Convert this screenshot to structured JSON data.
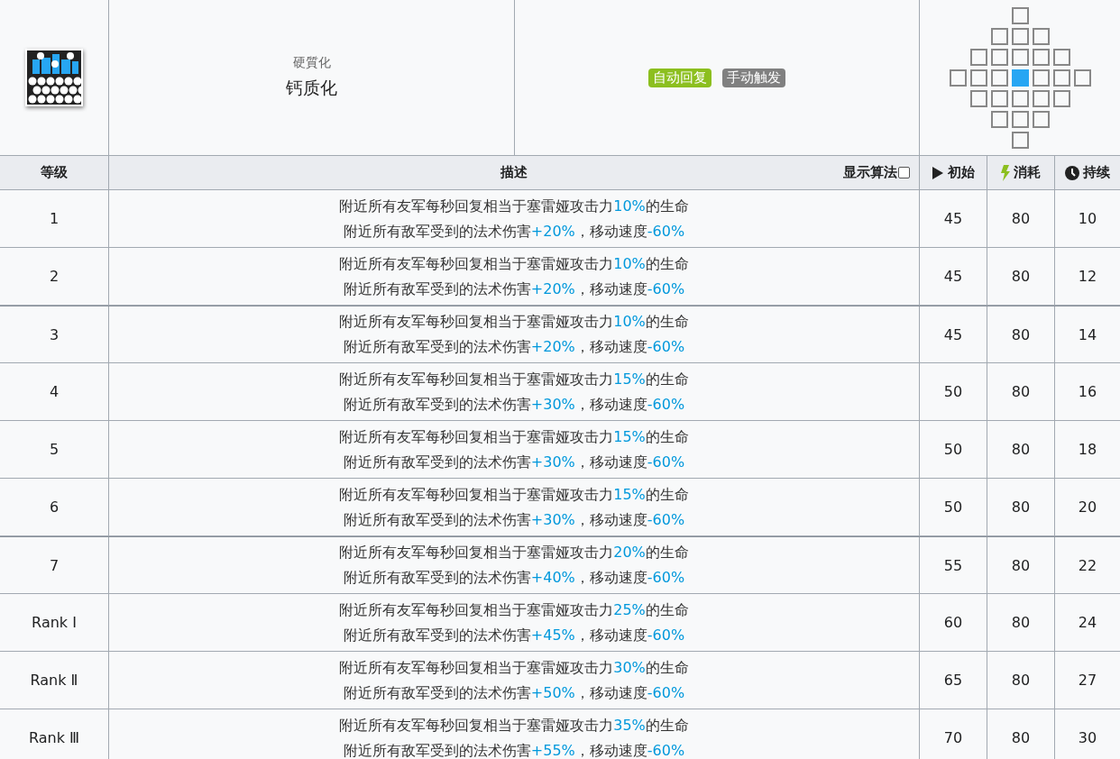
{
  "skill": {
    "subtitle": "硬質化",
    "name": "钙质化",
    "tags": [
      {
        "label": "自动回复",
        "color": "#8cbf1f"
      },
      {
        "label": "手动触发",
        "color": "#808080"
      }
    ]
  },
  "range": {
    "rows": [
      [
        {
          "selected": false
        }
      ],
      [
        {
          "selected": false
        },
        {
          "selected": false
        },
        {
          "selected": false
        }
      ],
      [
        {
          "selected": false
        },
        {
          "selected": false
        },
        {
          "selected": false
        },
        {
          "selected": false
        },
        {
          "selected": false
        }
      ],
      [
        {
          "selected": false
        },
        {
          "selected": false
        },
        {
          "selected": false
        },
        {
          "selected": true
        },
        {
          "selected": false
        },
        {
          "selected": false
        },
        {
          "selected": false
        }
      ],
      [
        {
          "selected": false
        },
        {
          "selected": false
        },
        {
          "selected": false
        },
        {
          "selected": false
        },
        {
          "selected": false
        }
      ],
      [
        {
          "selected": false
        },
        {
          "selected": false
        },
        {
          "selected": false
        }
      ],
      [
        {
          "selected": false
        }
      ]
    ]
  },
  "table": {
    "columns": {
      "level": "等级",
      "description": "描述",
      "formula_toggle": {
        "label": "显示算法",
        "checked": false
      },
      "initial": "初始",
      "cost": "消耗",
      "duration": "持续"
    },
    "rows": [
      {
        "level": "1",
        "strong_top": false,
        "lines": [
          [
            {
              "text": "附近所有友军每秒回复相当于塞雷娅攻击力",
              "highlight": false
            },
            {
              "text": "10%",
              "highlight": true
            },
            {
              "text": "的生命",
              "highlight": false
            }
          ],
          [
            {
              "text": "附近所有敌军受到的法术伤害",
              "highlight": false
            },
            {
              "text": "+20%",
              "highlight": true
            },
            {
              "text": "，移动速度",
              "highlight": false
            },
            {
              "text": "-60%",
              "highlight": true
            }
          ]
        ],
        "initial": "45",
        "cost": "80",
        "duration": "10"
      },
      {
        "level": "2",
        "strong_top": false,
        "lines": [
          [
            {
              "text": "附近所有友军每秒回复相当于塞雷娅攻击力",
              "highlight": false
            },
            {
              "text": "10%",
              "highlight": true
            },
            {
              "text": "的生命",
              "highlight": false
            }
          ],
          [
            {
              "text": "附近所有敌军受到的法术伤害",
              "highlight": false
            },
            {
              "text": "+20%",
              "highlight": true
            },
            {
              "text": "，移动速度",
              "highlight": false
            },
            {
              "text": "-60%",
              "highlight": true
            }
          ]
        ],
        "initial": "45",
        "cost": "80",
        "duration": "12"
      },
      {
        "level": "3",
        "strong_top": true,
        "lines": [
          [
            {
              "text": "附近所有友军每秒回复相当于塞雷娅攻击力",
              "highlight": false
            },
            {
              "text": "10%",
              "highlight": true
            },
            {
              "text": "的生命",
              "highlight": false
            }
          ],
          [
            {
              "text": "附近所有敌军受到的法术伤害",
              "highlight": false
            },
            {
              "text": "+20%",
              "highlight": true
            },
            {
              "text": "，移动速度",
              "highlight": false
            },
            {
              "text": "-60%",
              "highlight": true
            }
          ]
        ],
        "initial": "45",
        "cost": "80",
        "duration": "14"
      },
      {
        "level": "4",
        "strong_top": false,
        "lines": [
          [
            {
              "text": "附近所有友军每秒回复相当于塞雷娅攻击力",
              "highlight": false
            },
            {
              "text": "15%",
              "highlight": true
            },
            {
              "text": "的生命",
              "highlight": false
            }
          ],
          [
            {
              "text": "附近所有敌军受到的法术伤害",
              "highlight": false
            },
            {
              "text": "+30%",
              "highlight": true
            },
            {
              "text": "，移动速度",
              "highlight": false
            },
            {
              "text": "-60%",
              "highlight": true
            }
          ]
        ],
        "initial": "50",
        "cost": "80",
        "duration": "16"
      },
      {
        "level": "5",
        "strong_top": false,
        "lines": [
          [
            {
              "text": "附近所有友军每秒回复相当于塞雷娅攻击力",
              "highlight": false
            },
            {
              "text": "15%",
              "highlight": true
            },
            {
              "text": "的生命",
              "highlight": false
            }
          ],
          [
            {
              "text": "附近所有敌军受到的法术伤害",
              "highlight": false
            },
            {
              "text": "+30%",
              "highlight": true
            },
            {
              "text": "，移动速度",
              "highlight": false
            },
            {
              "text": "-60%",
              "highlight": true
            }
          ]
        ],
        "initial": "50",
        "cost": "80",
        "duration": "18"
      },
      {
        "level": "6",
        "strong_top": false,
        "lines": [
          [
            {
              "text": "附近所有友军每秒回复相当于塞雷娅攻击力",
              "highlight": false
            },
            {
              "text": "15%",
              "highlight": true
            },
            {
              "text": "的生命",
              "highlight": false
            }
          ],
          [
            {
              "text": "附近所有敌军受到的法术伤害",
              "highlight": false
            },
            {
              "text": "+30%",
              "highlight": true
            },
            {
              "text": "，移动速度",
              "highlight": false
            },
            {
              "text": "-60%",
              "highlight": true
            }
          ]
        ],
        "initial": "50",
        "cost": "80",
        "duration": "20"
      },
      {
        "level": "7",
        "strong_top": true,
        "lines": [
          [
            {
              "text": "附近所有友军每秒回复相当于塞雷娅攻击力",
              "highlight": false
            },
            {
              "text": "20%",
              "highlight": true
            },
            {
              "text": "的生命",
              "highlight": false
            }
          ],
          [
            {
              "text": "附近所有敌军受到的法术伤害",
              "highlight": false
            },
            {
              "text": "+40%",
              "highlight": true
            },
            {
              "text": "，移动速度",
              "highlight": false
            },
            {
              "text": "-60%",
              "highlight": true
            }
          ]
        ],
        "initial": "55",
        "cost": "80",
        "duration": "22"
      },
      {
        "level": "Rank Ⅰ",
        "strong_top": false,
        "lines": [
          [
            {
              "text": "附近所有友军每秒回复相当于塞雷娅攻击力",
              "highlight": false
            },
            {
              "text": "25%",
              "highlight": true
            },
            {
              "text": "的生命",
              "highlight": false
            }
          ],
          [
            {
              "text": "附近所有敌军受到的法术伤害",
              "highlight": false
            },
            {
              "text": "+45%",
              "highlight": true
            },
            {
              "text": "，移动速度",
              "highlight": false
            },
            {
              "text": "-60%",
              "highlight": true
            }
          ]
        ],
        "initial": "60",
        "cost": "80",
        "duration": "24"
      },
      {
        "level": "Rank Ⅱ",
        "strong_top": false,
        "lines": [
          [
            {
              "text": "附近所有友军每秒回复相当于塞雷娅攻击力",
              "highlight": false
            },
            {
              "text": "30%",
              "highlight": true
            },
            {
              "text": "的生命",
              "highlight": false
            }
          ],
          [
            {
              "text": "附近所有敌军受到的法术伤害",
              "highlight": false
            },
            {
              "text": "+50%",
              "highlight": true
            },
            {
              "text": "，移动速度",
              "highlight": false
            },
            {
              "text": "-60%",
              "highlight": true
            }
          ]
        ],
        "initial": "65",
        "cost": "80",
        "duration": "27"
      },
      {
        "level": "Rank Ⅲ",
        "strong_top": false,
        "lines": [
          [
            {
              "text": "附近所有友军每秒回复相当于塞雷娅攻击力",
              "highlight": false
            },
            {
              "text": "35%",
              "highlight": true
            },
            {
              "text": "的生命",
              "highlight": false
            }
          ],
          [
            {
              "text": "附近所有敌军受到的法术伤害",
              "highlight": false
            },
            {
              "text": "+55%",
              "highlight": true
            },
            {
              "text": "，移动速度",
              "highlight": false
            },
            {
              "text": "-60%",
              "highlight": true
            }
          ]
        ],
        "initial": "70",
        "cost": "80",
        "duration": "30"
      }
    ]
  }
}
